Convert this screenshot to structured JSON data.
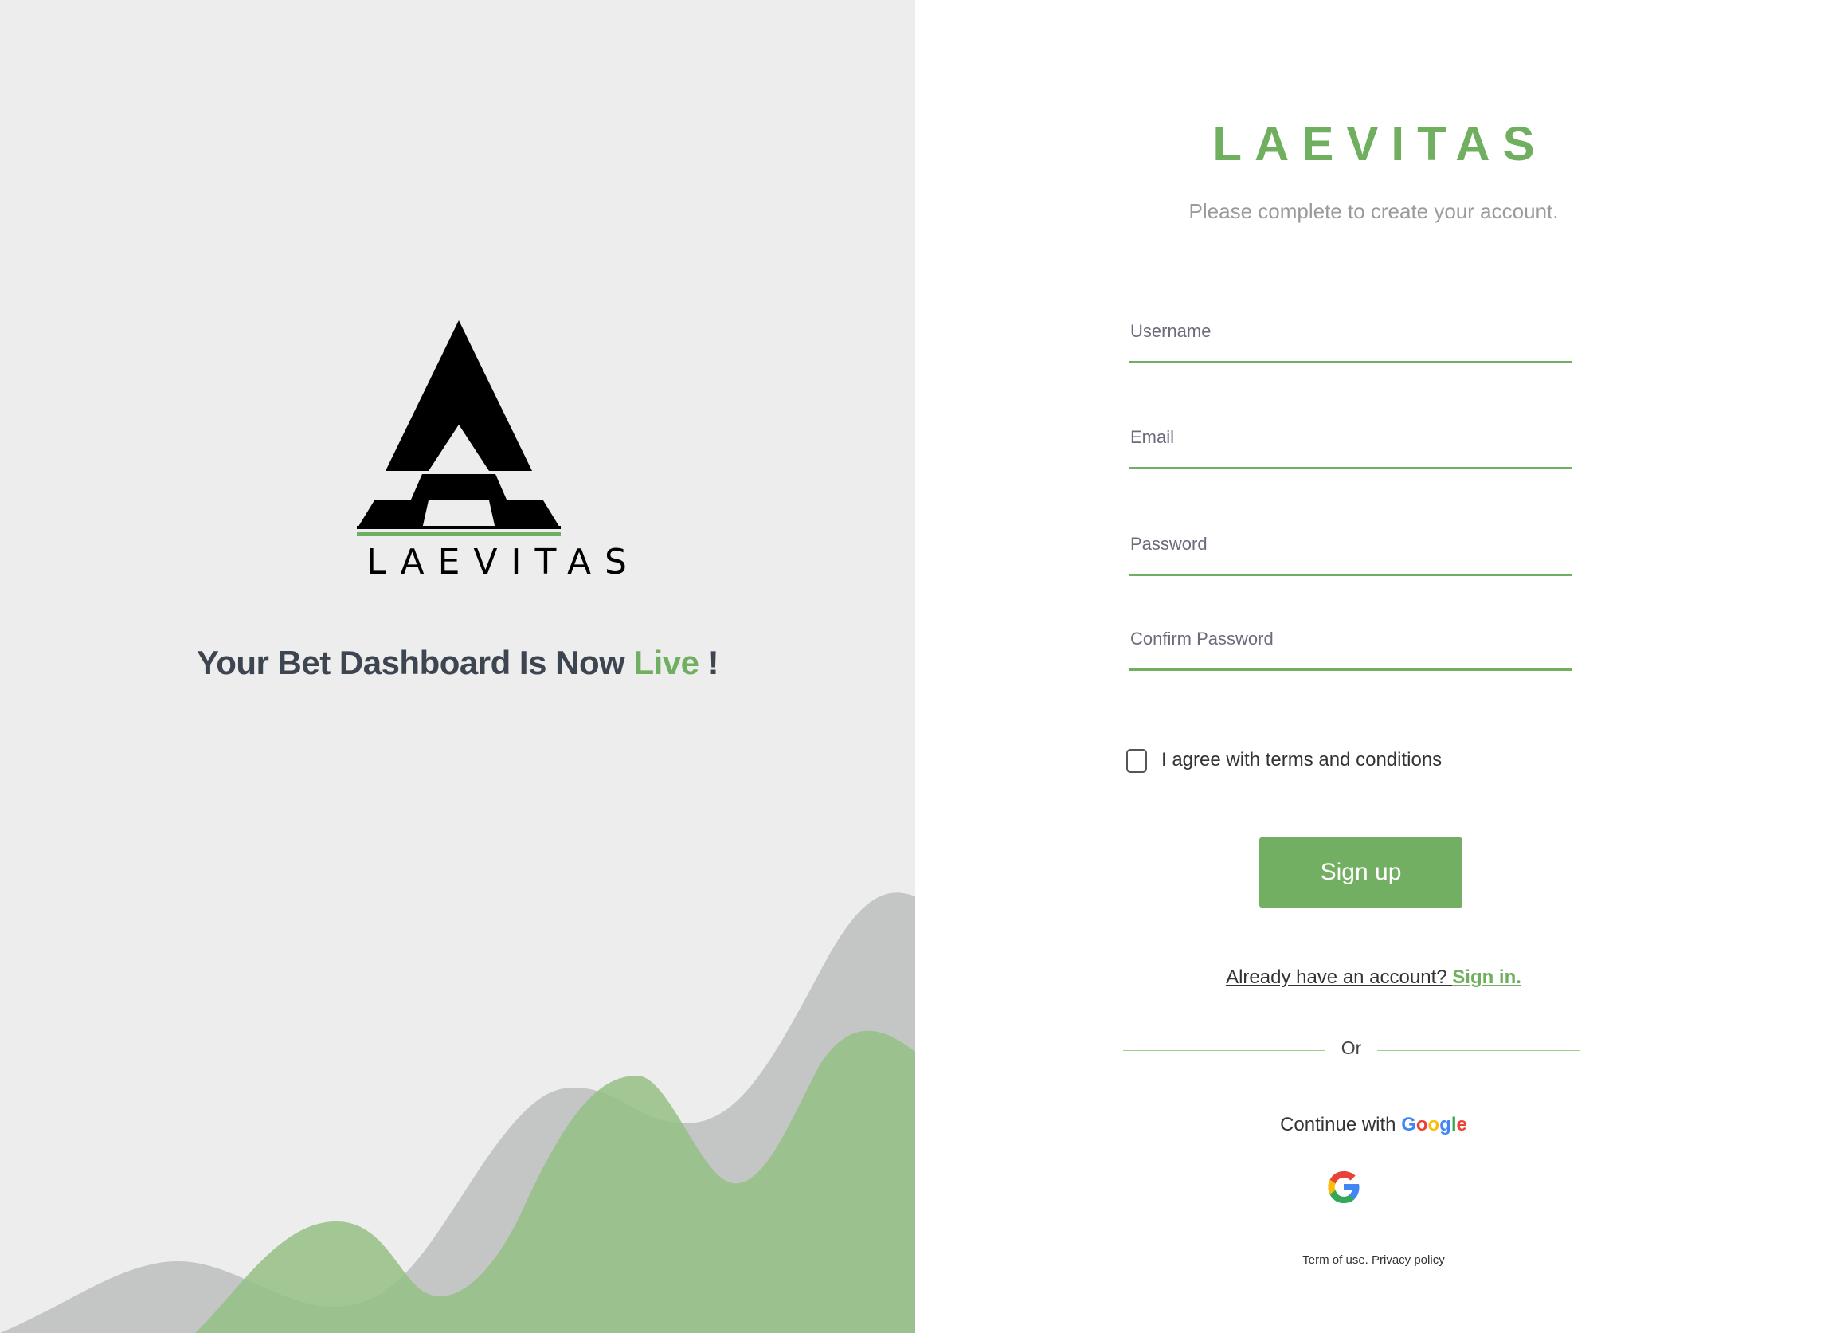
{
  "colors": {
    "accent": "#6faf5f",
    "button": "#72af62",
    "left_panel_bg": "#ededed",
    "tagline_text": "#3d4650"
  },
  "left_panel": {
    "logo_icon": "laevitas-triangle-logo-icon",
    "logo_text": "LAEVITAS",
    "tagline_main": "Your Bet Dashboard Is Now",
    "tagline_highlight": "Live",
    "tagline_end": "!"
  },
  "form": {
    "brand": "LAEVITAS",
    "subtitle": "Please complete to create your account.",
    "fields": {
      "username": {
        "label": "Username",
        "value": ""
      },
      "email": {
        "label": "Email",
        "value": ""
      },
      "password": {
        "label": "Password",
        "value": ""
      },
      "confirm_password": {
        "label": "Confirm Password",
        "value": ""
      }
    },
    "terms_label": "I agree with terms and conditions",
    "terms_checked": false,
    "signup_label": "Sign up",
    "signin_prompt": "Already have an account?",
    "signin_link": "Sign in.",
    "or_text": "Or",
    "continue_with": "Continue with",
    "google_word": {
      "g1": "G",
      "o1": "o",
      "o2": "o",
      "g2": "g",
      "l": "l",
      "e": "e"
    },
    "google_icon": "google-g-icon",
    "footer": {
      "terms": "Term of use.",
      "privacy": "Privacy policy"
    }
  }
}
